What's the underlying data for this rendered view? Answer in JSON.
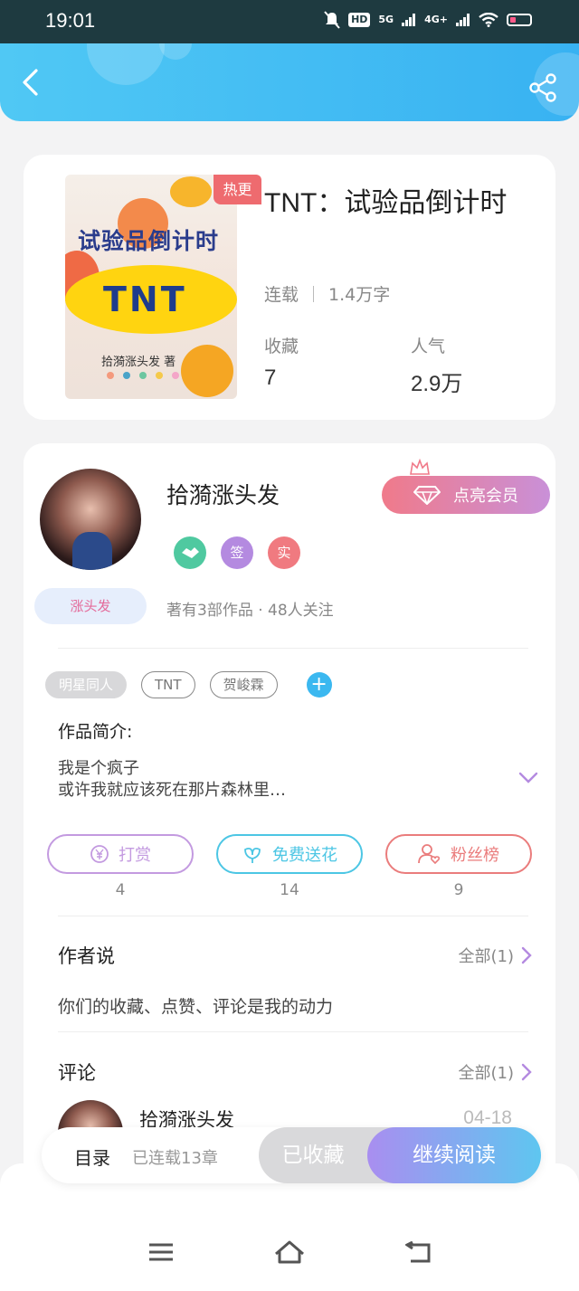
{
  "status_bar": {
    "time": "19:01",
    "hd_label": "HD",
    "sim1": "5G",
    "sim2": "4G+"
  },
  "book": {
    "hot_badge": "热更",
    "title": "TNT：试验品倒计时",
    "status": "连载",
    "word_count": "1.4万字",
    "favorites_label": "收藏",
    "favorites_value": "7",
    "popularity_label": "人气",
    "popularity_value": "2.9万",
    "cover_title": "试验品倒计时",
    "cover_logo": "TNT",
    "cover_author": "拾漪涨头发 著"
  },
  "author": {
    "name": "拾漪涨头发",
    "name_tag": "涨头发",
    "badges": [
      "签",
      "实"
    ],
    "vip_button": "点亮会员",
    "works_follow": "著有3部作品 · 48人关注"
  },
  "tags": [
    "明星同人",
    "TNT",
    "贺峻霖"
  ],
  "intro": {
    "label": "作品简介:",
    "line1": "我是个疯子",
    "line2": "或许我就应该死在那片森林里…"
  },
  "actions": [
    {
      "label": "打赏",
      "count": "4",
      "color": "#c39ae0"
    },
    {
      "label": "免费送花",
      "count": "14",
      "color": "#4cc6e4"
    },
    {
      "label": "粉丝榜",
      "count": "9",
      "color": "#ea7c7c"
    }
  ],
  "author_says": {
    "title": "作者说",
    "more": "全部(1)",
    "text": "你们的收藏、点赞、评论是我的动力"
  },
  "comments": {
    "title": "评论",
    "more": "全部(1)",
    "first_name": "拾漪涨头发",
    "first_date": "04-18"
  },
  "read_bar": {
    "toc": "目录",
    "serialized": "已连载13章",
    "favorited": "已收藏",
    "continue": "继续阅读"
  },
  "colors": {
    "header": "#3fb8f3",
    "accent_purple": "#a98ef0",
    "accent_blue": "#5ec6f0",
    "hot_red": "#ee6b6f"
  }
}
